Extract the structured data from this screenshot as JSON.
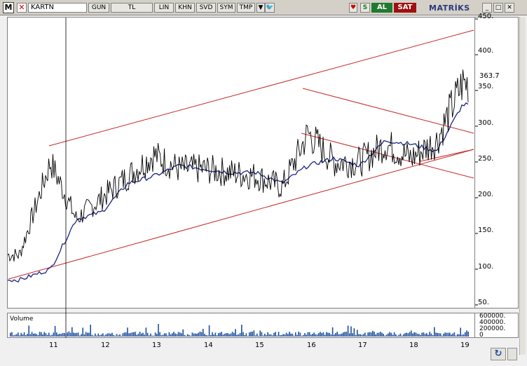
{
  "toolbar": {
    "logo": "M",
    "close": "✕",
    "symbol": "KARTN",
    "buttons": [
      "GUN",
      "TL",
      "LIN",
      "KHN",
      "SVD",
      "SYM",
      "TMP"
    ],
    "dropdown": "▼",
    "icon_a": "♥",
    "icon_b": "S",
    "icon_c": "🐦",
    "buy_label": "AL",
    "sell_label": "SAT",
    "brand": "MATRİKS",
    "win_buttons": [
      "_",
      "□",
      "✕"
    ]
  },
  "axis": {
    "price_ticks": [
      "400.",
      "350.",
      "300.",
      "250.",
      "200.",
      "150.",
      "100.",
      "50."
    ],
    "top_tick": "450.",
    "last_price": "363.7"
  },
  "volume": {
    "label": "Volume",
    "ticks": [
      "600000.",
      "400000.",
      "200000.",
      "0"
    ]
  },
  "dates": [
    "11",
    "12",
    "13",
    "14",
    "15",
    "16",
    "17",
    "18",
    "19"
  ],
  "colors": {
    "price_line": "#000000",
    "moving_average": "#1a237e",
    "trend_channel": "#c62828",
    "volume_bars": "#1e4f9c"
  },
  "chart_data": {
    "type": "line",
    "series": [
      {
        "x": [
          "11",
          "11.5",
          "12",
          "12.5",
          "13",
          "13.5",
          "14",
          "14.5",
          "15",
          "15.5",
          "16",
          "16.5",
          "17",
          "17.5",
          "18",
          "18.5",
          "19"
        ],
        "values": [
          250,
          170,
          200,
          230,
          260,
          240,
          240,
          235,
          230,
          215,
          290,
          250,
          250,
          275,
          255,
          280,
          360
        ]
      },
      {
        "x": [
          "11",
          "11.5",
          "12",
          "12.5",
          "13",
          "13.5",
          "14",
          "14.5",
          "15",
          "15.5",
          "16",
          "16.5",
          "17",
          "17.5",
          "18",
          "18.5",
          "19"
        ],
        "values": [
          100,
          170,
          180,
          220,
          230,
          245,
          240,
          235,
          235,
          220,
          245,
          255,
          245,
          280,
          275,
          265,
          330
        ]
      }
    ],
    "ylim": [
      45,
      452
    ],
    "grid": false
  }
}
